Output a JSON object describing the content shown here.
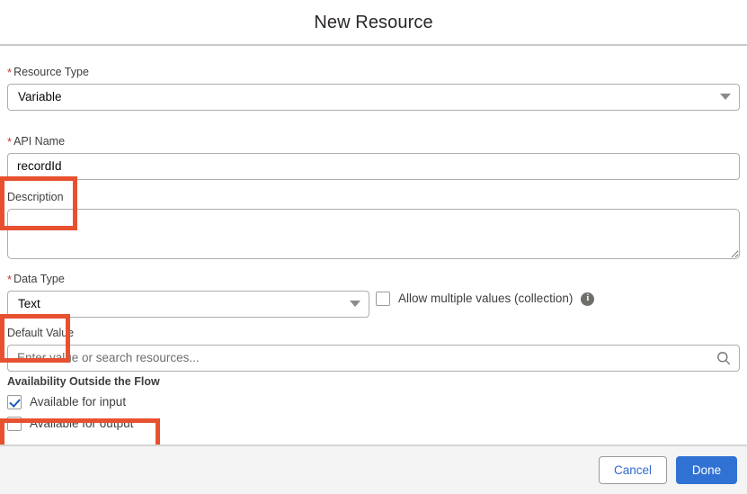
{
  "header": {
    "title": "New Resource"
  },
  "form": {
    "resource_type": {
      "label": "Resource Type",
      "required_marker": "*",
      "value": "Variable",
      "caret_icon": "chevron-down-icon"
    },
    "api_name": {
      "label": "API Name",
      "required_marker": "*",
      "value": "recordId"
    },
    "description": {
      "label": "Description",
      "value": "",
      "placeholder": ""
    },
    "data_type": {
      "label": "Data Type",
      "required_marker": "*",
      "value": "Text",
      "caret_icon": "chevron-down-icon"
    },
    "allow_multiple": {
      "label": "Allow multiple values (collection)",
      "checked": false,
      "info_icon": "info-icon",
      "info_glyph": "i"
    },
    "default_value": {
      "label": "Default Value",
      "value": "",
      "placeholder": "Enter value or search resources...",
      "search_icon": "search-icon"
    },
    "availability": {
      "title": "Availability Outside the Flow",
      "options": [
        {
          "label": "Available for input",
          "checked": true
        },
        {
          "label": "Available for output",
          "checked": false
        }
      ]
    }
  },
  "footer": {
    "cancel_label": "Cancel",
    "done_label": "Done"
  },
  "annotations": {
    "highlight_color": "#e8512f",
    "boxes": [
      "api-name",
      "data-type",
      "availability-outside-the-flow"
    ]
  },
  "colors": {
    "primary_button": "#3072d3",
    "link_text": "#2f6bd1",
    "required_star": "#c23934",
    "checkbox_check": "#1b5eba",
    "highlight": "#e8512f"
  }
}
